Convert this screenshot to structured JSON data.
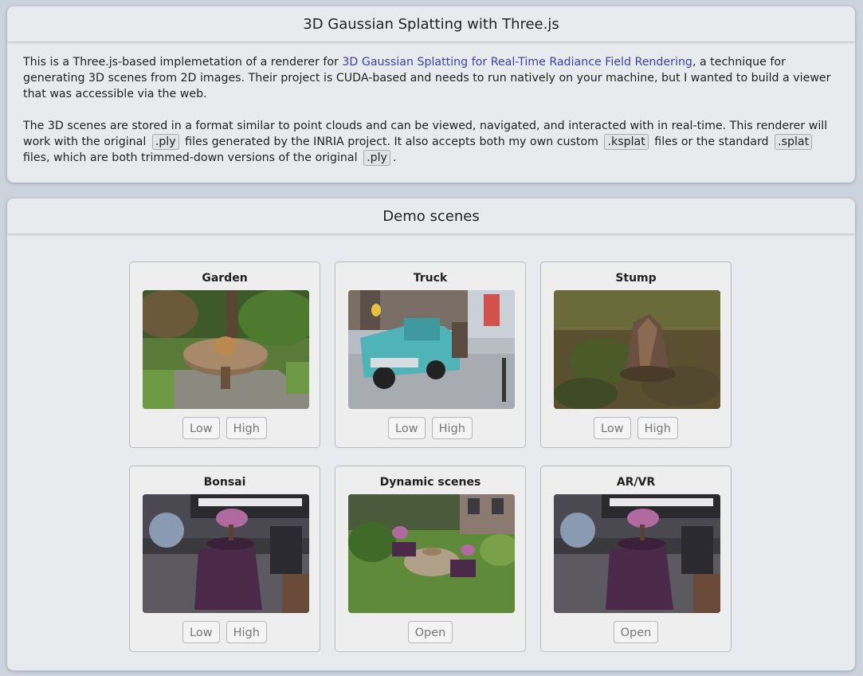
{
  "intro": {
    "title": "3D Gaussian Splatting with Three.js",
    "p1_before": "This is a Three.js-based implemetation of a renderer for ",
    "p1_link": "3D Gaussian Splatting for Real-Time Radiance Field Rendering",
    "p1_after": ", a technique for generating 3D scenes from 2D images. Their project is CUDA-based and needs to run natively on your machine, but I wanted to build a viewer that was accessible via the web.",
    "p2_a": "The 3D scenes are stored in a format similar to point clouds and can be viewed, navigated, and interacted with in real-time. This renderer will work with the original ",
    "code_ply": ".ply",
    "p2_b": " files generated by the INRIA project. It also accepts both my own custom ",
    "code_ksplat": ".ksplat",
    "p2_c": " files or the standard ",
    "code_splat": ".splat",
    "p2_d": " files, which are both trimmed-down versions of the original ",
    "p2_end": "."
  },
  "demos": {
    "title": "Demo scenes",
    "scenes": [
      {
        "title": "Garden",
        "buttons": [
          "Low",
          "High"
        ]
      },
      {
        "title": "Truck",
        "buttons": [
          "Low",
          "High"
        ]
      },
      {
        "title": "Stump",
        "buttons": [
          "Low",
          "High"
        ]
      },
      {
        "title": "Bonsai",
        "buttons": [
          "Low",
          "High"
        ]
      },
      {
        "title": "Dynamic scenes",
        "buttons": [
          "Open"
        ]
      },
      {
        "title": "AR/VR",
        "buttons": [
          "Open"
        ]
      }
    ]
  },
  "colors": {
    "background": "#ccd3dd",
    "panel": "#e8eaed",
    "link": "#3b3fb5"
  }
}
